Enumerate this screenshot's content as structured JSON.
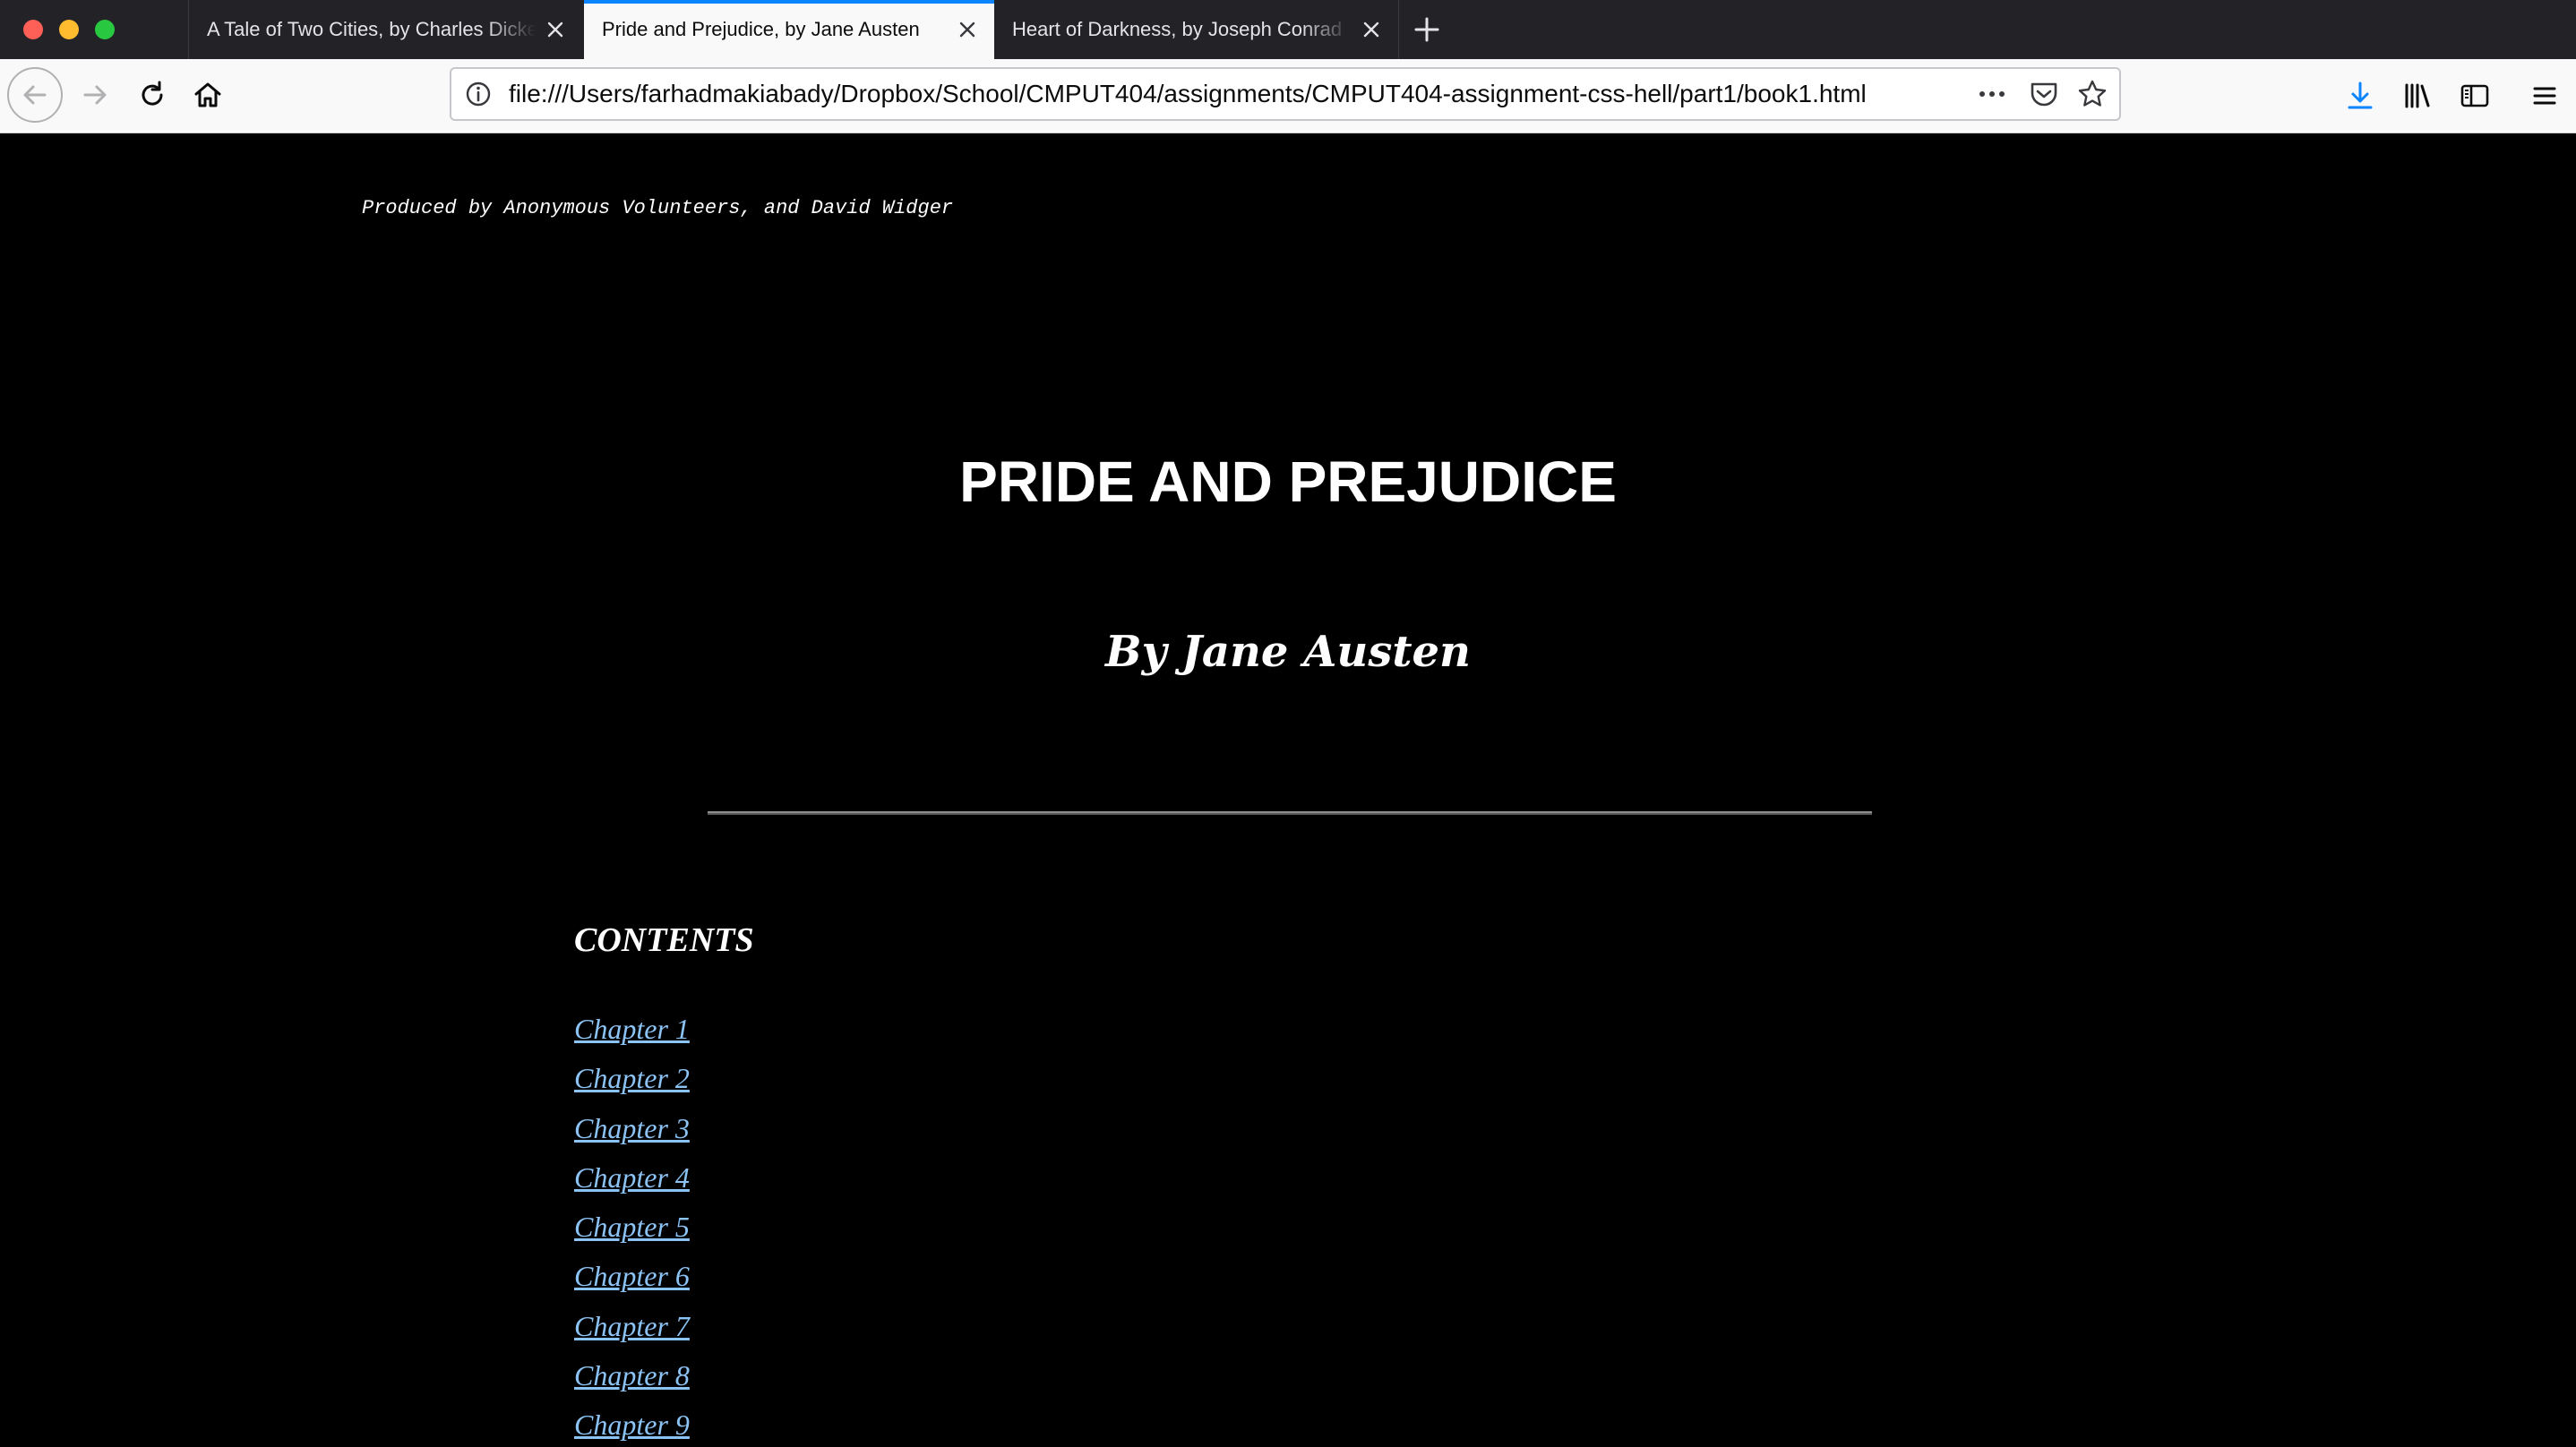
{
  "browser": {
    "tabs": [
      {
        "title": "A Tale of Two Cities, by Charles Dickens",
        "active": false
      },
      {
        "title": "Pride and Prejudice, by Jane Austen",
        "active": true
      },
      {
        "title": "Heart of Darkness, by Joseph Conrad",
        "active": false
      }
    ],
    "url": "file:///Users/farhadmakiabady/Dropbox/School/CMPUT404/assignments/CMPUT404-assignment-css-hell/part1/book1.html",
    "accent_color": "#0a84ff",
    "icons": [
      "back-icon",
      "forward-icon",
      "reload-icon",
      "home-icon",
      "info-icon",
      "more-icon",
      "pocket-icon",
      "star-icon",
      "download-icon",
      "library-icon",
      "sidebar-icon",
      "menu-icon",
      "close-icon",
      "new-tab-icon"
    ]
  },
  "page": {
    "produced_by": "Produced by Anonymous Volunteers, and David Widger",
    "title": "PRIDE AND PREJUDICE",
    "author": "By Jane Austen",
    "contents_heading": "CONTENTS",
    "chapters": [
      "Chapter 1",
      "Chapter 2",
      "Chapter 3",
      "Chapter 4",
      "Chapter 5",
      "Chapter 6",
      "Chapter 7",
      "Chapter 8",
      "Chapter 9"
    ],
    "background_color": "#000000",
    "text_color": "#ffffff",
    "link_color": "#8cc3f5"
  }
}
